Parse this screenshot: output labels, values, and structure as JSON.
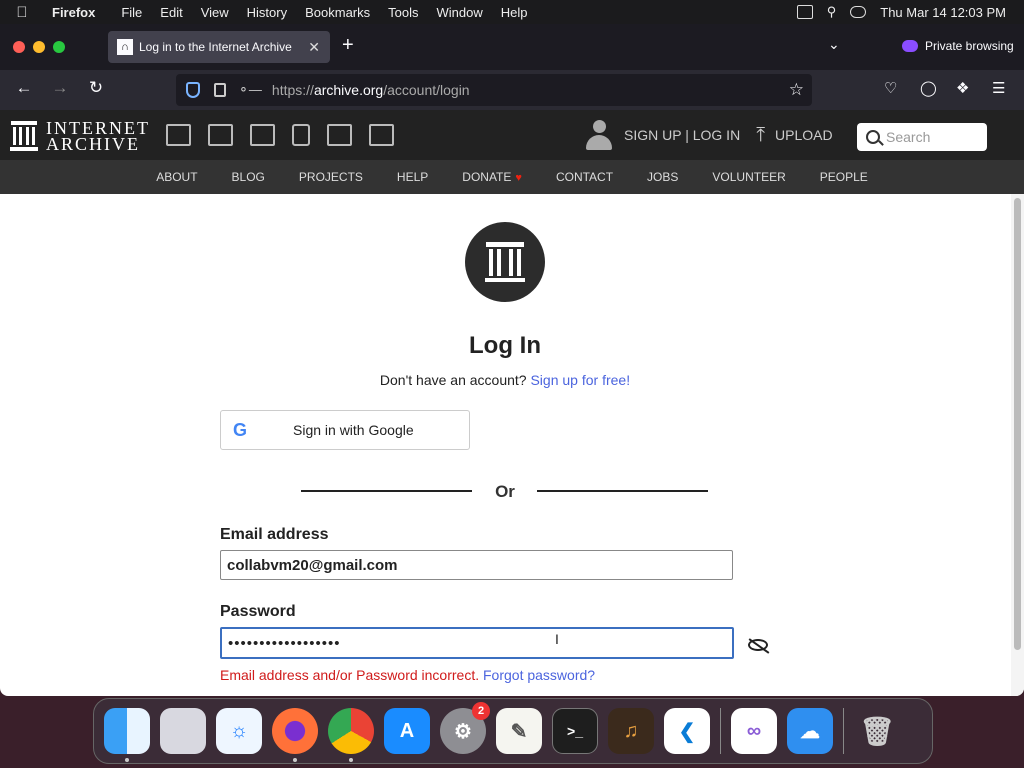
{
  "menubar": {
    "apple": "",
    "app": "Firefox",
    "menus": [
      "File",
      "Edit",
      "View",
      "History",
      "Bookmarks",
      "Tools",
      "Window",
      "Help"
    ],
    "clock": "Thu Mar 14  12:03 PM"
  },
  "browser": {
    "tab_title": "Log in to the Internet Archive",
    "private_label": "Private browsing",
    "url_prefix": "https://",
    "url_host": "archive.org",
    "url_path": "/account/login"
  },
  "archive": {
    "logo_line1": "INTERNET",
    "logo_line2": "ARCHIVE",
    "signup_login": "SIGN UP | LOG IN",
    "upload": "UPLOAD",
    "search_placeholder": "Search",
    "nav": [
      "ABOUT",
      "BLOG",
      "PROJECTS",
      "HELP",
      "DONATE",
      "CONTACT",
      "JOBS",
      "VOLUNTEER",
      "PEOPLE"
    ]
  },
  "login": {
    "title": "Log In",
    "no_account": "Don't have an account?",
    "signup_link": "Sign up for free!",
    "google_button": "Sign in with Google",
    "or": "Or",
    "email_label": "Email address",
    "email_value": "collabvm20@gmail.com",
    "password_label": "Password",
    "password_value": "••••••••••••••••••",
    "error": "Email address and/or Password incorrect.",
    "forgot": "Forgot password?"
  },
  "dock": {
    "settings_badge": "2"
  },
  "colors": {
    "link": "#4b64de",
    "error": "#d01b1b",
    "focus": "#3b6fc0"
  }
}
